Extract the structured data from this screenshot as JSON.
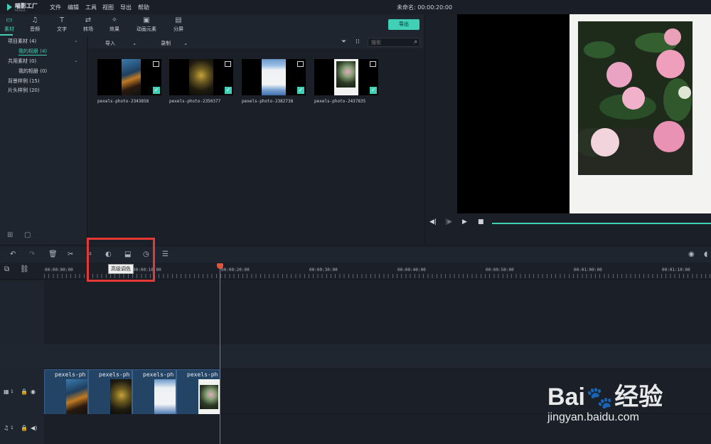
{
  "app": {
    "logo_text": "喵影工厂",
    "logo_sub": "Filmora",
    "title": "未命名: 00:00:20:00"
  },
  "menu": [
    "文件",
    "编辑",
    "工具",
    "视图",
    "导出",
    "帮助"
  ],
  "library_tabs": [
    {
      "label": "素材",
      "icon": "folder-icon",
      "active": true
    },
    {
      "label": "音频",
      "icon": "music-icon",
      "active": false
    },
    {
      "label": "文字",
      "icon": "text-icon",
      "active": false
    },
    {
      "label": "转场",
      "icon": "transition-icon",
      "active": false
    },
    {
      "label": "效果",
      "icon": "effects-icon",
      "active": false
    },
    {
      "label": "动画元素",
      "icon": "elements-icon",
      "active": false
    },
    {
      "label": "分屏",
      "icon": "split-screen-icon",
      "active": false
    }
  ],
  "export_label": "导出",
  "sidebar": {
    "items": [
      {
        "label": "项目素材 (4)",
        "expandable": true
      },
      {
        "label": "我的相册 (4)",
        "selected": true
      },
      {
        "label": "共用素材 (0)",
        "expandable": true
      },
      {
        "label": "我的相册 (0)"
      },
      {
        "label": "背景样例 (15)"
      },
      {
        "label": "片头样例 (20)"
      }
    ]
  },
  "media_bar": {
    "import_label": "导入",
    "record_label": "录制",
    "search_placeholder": "搜索"
  },
  "media_items": [
    {
      "name": "pexels-photo-2343858"
    },
    {
      "name": "pexels-photo-2350377"
    },
    {
      "name": "pexels-photo-2382738"
    },
    {
      "name": "pexels-photo-2437835"
    }
  ],
  "tooltip": "高级调色",
  "ruler_labels": [
    "00:00:00:00",
    "00:00:10:00",
    "00:00:20:00",
    "00:00:30:00",
    "00:00:40:00",
    "00:00:50:00",
    "00:01:00:00",
    "00:01:10:00"
  ],
  "clips": [
    "pexels-ph",
    "pexels-ph",
    "pexels-ph",
    "pexels-ph"
  ],
  "track_labels": {
    "video": "1",
    "audio": "1"
  },
  "watermark": {
    "brand": "Bai",
    "brand2": "经验",
    "url": "jingyan.baidu.com"
  },
  "colors": {
    "accent": "#3fd0b6",
    "playhead": "#e5533d",
    "highlight": "#e53935"
  }
}
